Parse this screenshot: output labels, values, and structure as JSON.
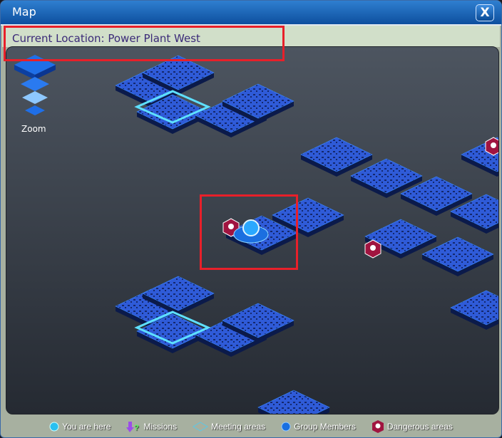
{
  "window": {
    "title": "Map",
    "close_label": "X"
  },
  "location": {
    "text": "Current Location: Power Plant West"
  },
  "zoom": {
    "label": "Zoom"
  },
  "legend": [
    {
      "label": "You are here",
      "icon": "you-are-here-icon"
    },
    {
      "label": "Missions",
      "icon": "missions-icon"
    },
    {
      "label": "Meeting areas",
      "icon": "meeting-areas-icon"
    },
    {
      "label": "Group Members",
      "icon": "group-members-icon"
    },
    {
      "label": "Dangerous areas",
      "icon": "dangerous-areas-icon"
    }
  ],
  "colors": {
    "tile": "#2f5bd8",
    "tile_dark": "#0b1a4a",
    "danger": "#a01440",
    "accent": "#3fd0ff"
  }
}
